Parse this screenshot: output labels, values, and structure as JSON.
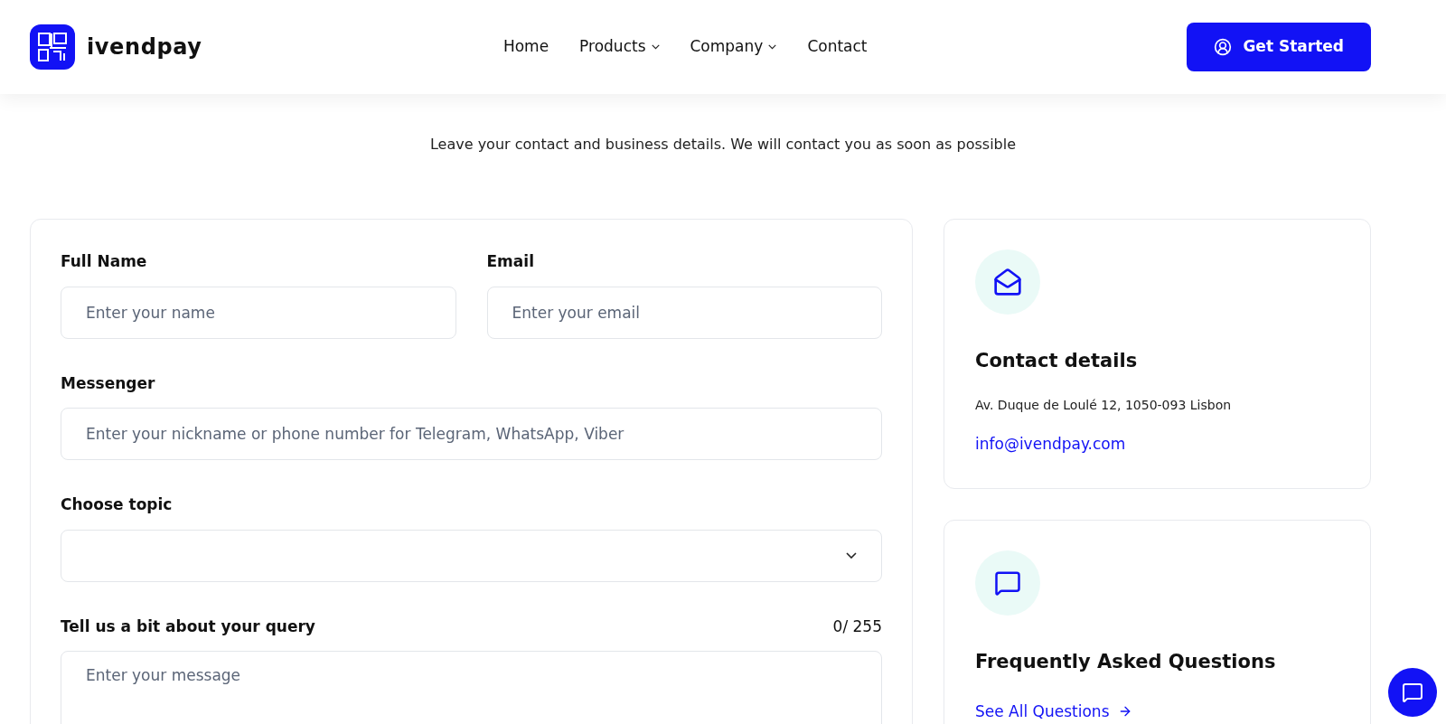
{
  "header": {
    "logo_text": "ivendpay",
    "nav": [
      {
        "label": "Home",
        "dropdown": false
      },
      {
        "label": "Products",
        "dropdown": true
      },
      {
        "label": "Company",
        "dropdown": true
      },
      {
        "label": "Contact",
        "dropdown": false
      }
    ],
    "cta": "Get Started"
  },
  "intro": {
    "subtitle": "Leave your contact and business details. We will contact you as soon as possible"
  },
  "form": {
    "rows": [
      {
        "fields": [
          {
            "kind": "text",
            "label": "Full Name",
            "placeholder": "Enter your name"
          },
          {
            "kind": "text",
            "label": "Email",
            "placeholder": "Enter your email"
          }
        ]
      },
      {
        "fields": [
          {
            "kind": "text",
            "label": "Messenger",
            "placeholder": "Enter your nickname or phone number for Telegram, WhatsApp, Viber"
          }
        ]
      },
      {
        "fields": [
          {
            "kind": "select",
            "label": "Choose topic"
          }
        ]
      },
      {
        "fields": [
          {
            "kind": "textarea",
            "label": "Tell us a bit about your query",
            "counter": "0/ 255",
            "placeholder": "Enter your message"
          }
        ]
      }
    ]
  },
  "contact_card": {
    "title": "Contact details",
    "address": "Av. Duque de Loulé 12, 1050-093 Lisbon",
    "email": "info@ivendpay.com"
  },
  "faq_card": {
    "title": "Frequently Asked Questions",
    "link": "See All Questions"
  }
}
